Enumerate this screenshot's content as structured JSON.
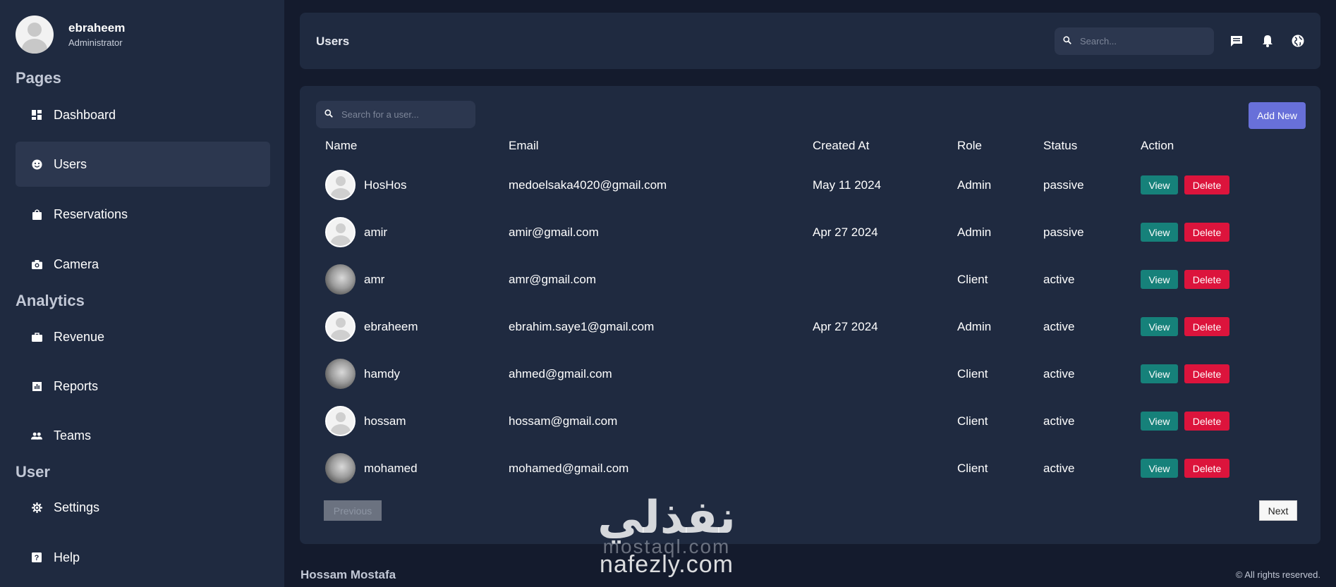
{
  "profile": {
    "name": "ebraheem",
    "role": "Administrator"
  },
  "sidebar": {
    "sections": [
      "Pages",
      "Analytics",
      "User"
    ],
    "items": [
      {
        "label": "Dashboard",
        "icon": "dashboard-icon"
      },
      {
        "label": "Users",
        "icon": "smile-icon",
        "active": true
      },
      {
        "label": "Reservations",
        "icon": "shopping-bag-icon"
      },
      {
        "label": "Camera",
        "icon": "camera-icon"
      },
      {
        "label": "Revenue",
        "icon": "briefcase-icon"
      },
      {
        "label": "Reports",
        "icon": "bar-chart-icon"
      },
      {
        "label": "Teams",
        "icon": "people-icon"
      },
      {
        "label": "Settings",
        "icon": "gear-icon"
      },
      {
        "label": "Help",
        "icon": "help-icon"
      }
    ]
  },
  "header": {
    "title": "Users",
    "search_placeholder": "Search...",
    "icons": [
      "chat-icon",
      "bell-icon",
      "globe-icon"
    ]
  },
  "users_panel": {
    "search_placeholder": "Search for a user...",
    "add_new_label": "Add New",
    "columns": [
      "Name",
      "Email",
      "Created At",
      "Role",
      "Status",
      "Action"
    ],
    "rows": [
      {
        "name": "HosHos",
        "email": "medoelsaka4020@gmail.com",
        "created_at": "May 11 2024",
        "role": "Admin",
        "status": "passive",
        "avatar": "default"
      },
      {
        "name": "amir",
        "email": "amir@gmail.com",
        "created_at": "Apr 27 2024",
        "role": "Admin",
        "status": "passive",
        "avatar": "default"
      },
      {
        "name": "amr",
        "email": "amr@gmail.com",
        "created_at": "",
        "role": "Client",
        "status": "active",
        "avatar": "photo"
      },
      {
        "name": "ebraheem",
        "email": "ebrahim.saye1@gmail.com",
        "created_at": "Apr 27 2024",
        "role": "Admin",
        "status": "active",
        "avatar": "default"
      },
      {
        "name": "hamdy",
        "email": "ahmed@gmail.com",
        "created_at": "",
        "role": "Client",
        "status": "active",
        "avatar": "photo"
      },
      {
        "name": "hossam",
        "email": "hossam@gmail.com",
        "created_at": "",
        "role": "Client",
        "status": "active",
        "avatar": "default"
      },
      {
        "name": "mohamed",
        "email": "mohamed@gmail.com",
        "created_at": "",
        "role": "Client",
        "status": "active",
        "avatar": "photo"
      }
    ],
    "view_label": "View",
    "delete_label": "Delete",
    "previous_label": "Previous",
    "next_label": "Next"
  },
  "footer": {
    "author": "Hossam Mostafa",
    "rights": "© All rights reserved."
  },
  "watermark": {
    "arabic": "نفذلي",
    "line1": "mostaql.com",
    "line2": "nafezly.com"
  },
  "colors": {
    "background": "#141b2d",
    "panel": "#1f2a40",
    "accent": "#6870d9",
    "view": "#16817a",
    "delete": "#dc143c"
  }
}
